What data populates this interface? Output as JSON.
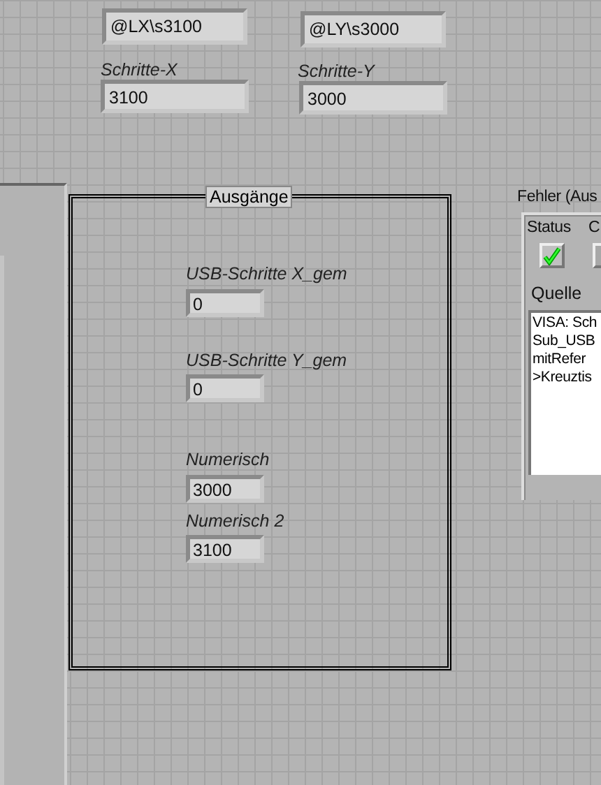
{
  "top_controls": [
    {
      "value": "@LX\\s3100"
    },
    {
      "value": "@LY\\s3000"
    },
    {
      "label": "Schritte-X",
      "value": "3100"
    },
    {
      "label": "Schritte-Y",
      "value": "3000"
    }
  ],
  "outputs": {
    "title": "Ausgänge",
    "items": [
      {
        "label": "USB-Schritte X_gem",
        "value": "0"
      },
      {
        "label": "USB-Schritte Y_gem",
        "value": "0"
      },
      {
        "label": "Numerisch",
        "value": "3000"
      },
      {
        "label": "Numerisch 2",
        "value": "3100"
      }
    ]
  },
  "error": {
    "title": "Fehler (Aus",
    "status_label": "Status",
    "status_checked": true,
    "code_label": "C",
    "source_label": "Quelle",
    "source_lines": [
      "VISA: Sch",
      "Sub_USB",
      "mitRefer",
      ">Kreuztis"
    ]
  }
}
